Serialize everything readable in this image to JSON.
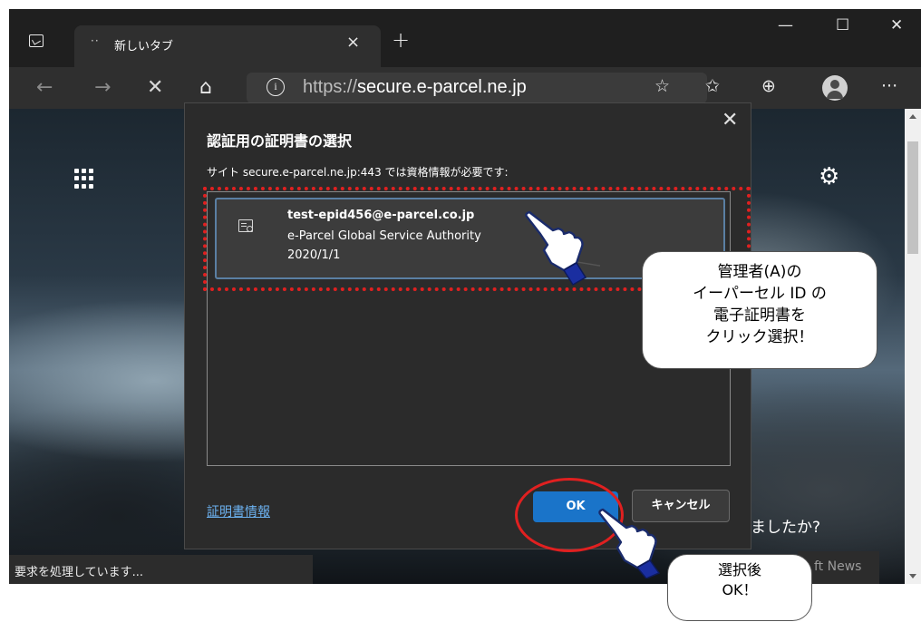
{
  "tab": {
    "title": "新しいタブ",
    "favicon": "··"
  },
  "window_controls": {
    "minimize": "—",
    "maximize": "☐",
    "close": "✕"
  },
  "url": {
    "scheme": "https://",
    "host": "secure.e-parcel.ne.jp"
  },
  "dialog": {
    "title": "認証用の証明書の選択",
    "subtitle": "サイト secure.e-parcel.ne.jp:443 では資格情報が必要です:",
    "certificates": [
      {
        "email": "test-epid456@e-parcel.co.jp",
        "authority": "e-Parcel Global Service Authority",
        "date": "2020/1/1"
      }
    ],
    "cert_info_link": "証明書情報",
    "ok_label": "OK",
    "cancel_label": "キャンセル"
  },
  "status_text": "要求を処理しています...",
  "background": {
    "headline_fragment": "ましたか?",
    "news_chip": "ft News"
  },
  "callouts": {
    "select_cert": [
      "管理者(A)の",
      "イーパーセル ID の",
      "電子証明書を",
      "クリック選択！"
    ],
    "press_ok": [
      "選択後",
      "OK！"
    ]
  },
  "colors": {
    "accent": "#1a74c9",
    "highlight": "#e02020",
    "link": "#6cb2f0"
  }
}
